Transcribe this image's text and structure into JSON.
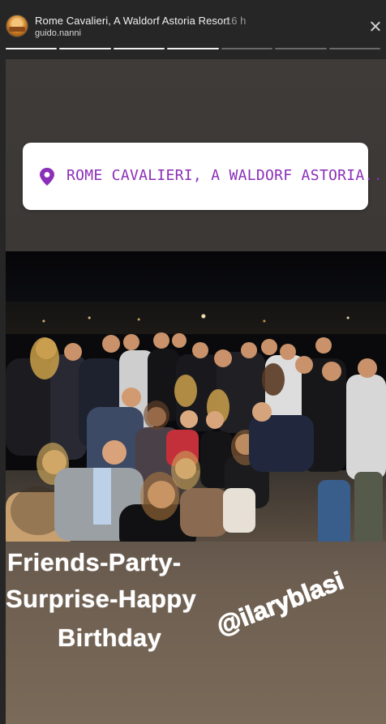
{
  "header": {
    "account_name": "Rome Cavalieri, A Waldorf Astoria Resort",
    "time_ago": "16 h",
    "username": "guido.nanni"
  },
  "progress": {
    "total_segments": 7,
    "completed_segments": 4
  },
  "story": {
    "location_sticker": "ROME CAVALIERI, A WALDORF ASTORIA...",
    "caption_lines": [
      "Friends-Party-",
      "Surprise-Happy",
      "Birthday"
    ],
    "mention": "@ilaryblasi"
  },
  "colors": {
    "location_text": "#8b2fb8",
    "background": "#262626",
    "caption": "#ffffff"
  },
  "icons": {
    "avatar": "resort-avatar",
    "close": "close-icon",
    "pin": "location-pin-icon"
  }
}
